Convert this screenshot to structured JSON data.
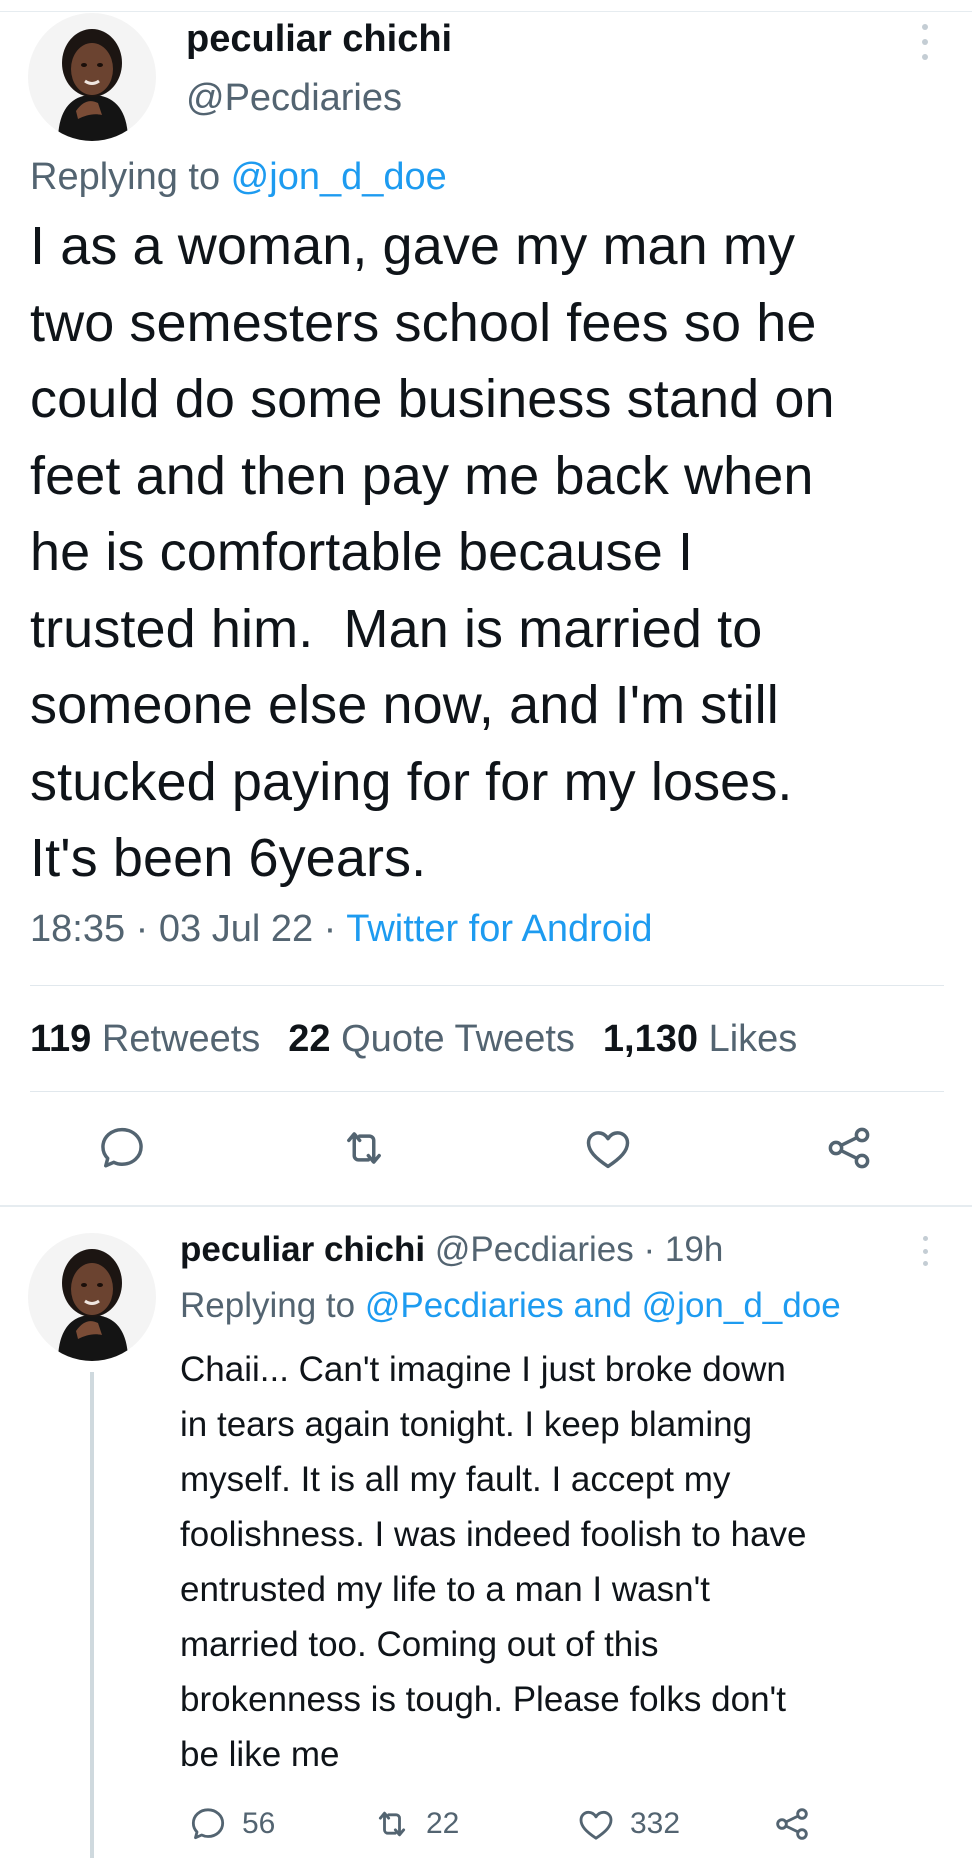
{
  "main_tweet": {
    "author": {
      "display_name": "peculiar chichi",
      "handle": "@Pecdiaries"
    },
    "replying_to_prefix": "Replying to ",
    "replying_to": "@jon_d_doe",
    "text": "I as a woman, gave my man my\ntwo semesters school fees so he\ncould do some business stand on\nfeet and then pay me back when\nhe is comfortable because I\ntrusted him.  Man is married to\nsomeone else now, and I'm still\nstucked paying for for my loses.\nIt's been 6years.",
    "time": "18:35",
    "date": "03 Jul 22",
    "separator": " · ",
    "source": "Twitter for Android",
    "stats": {
      "retweets_count": "119",
      "retweets_label": "Retweets",
      "quote_tweets_count": "22",
      "quote_tweets_label": "Quote Tweets",
      "likes_count": "1,130",
      "likes_label": "Likes"
    },
    "actions": [
      "reply-icon",
      "retweet-icon",
      "like-icon",
      "share-icon"
    ]
  },
  "reply_tweet": {
    "display_name": "peculiar chichi",
    "handle": "@Pecdiaries",
    "dot": " · ",
    "age": "19h",
    "replying_to_prefix": "Replying to ",
    "replying_to_1": "@Pecdiaries",
    "replying_to_and": " and ",
    "replying_to_2": "@jon_d_doe",
    "text": "Chaii... Can't imagine I just broke down\nin tears again tonight. I keep blaming\nmyself. It is all my fault. I accept my\nfoolishness. I was indeed foolish to have\nentrusted my life to a man I wasn't\nmarried too. Coming out of this\nbrokenness is tough. Please folks don't\nbe like me",
    "reply_count": "56",
    "retweet_count": "22",
    "like_count": "332"
  },
  "colors": {
    "accent": "#1d9bf0",
    "secondary_text": "#536471",
    "primary_text": "#0f1419",
    "divider": "#e1e8ed"
  }
}
